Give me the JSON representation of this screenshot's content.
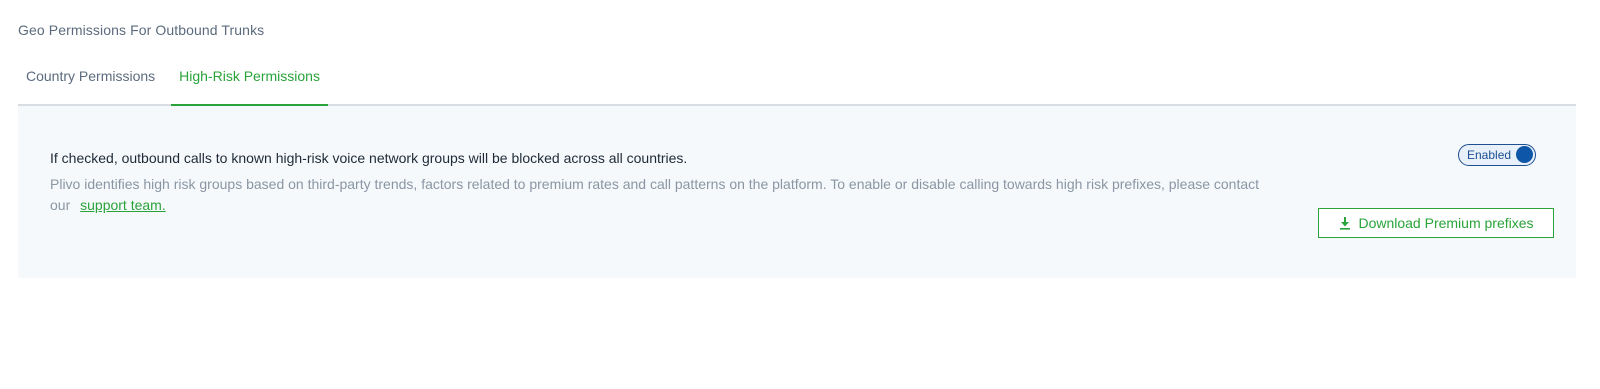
{
  "section": {
    "title": "Geo Permissions For Outbound Trunks"
  },
  "tabs": [
    {
      "label": "Country Permissions",
      "active": false
    },
    {
      "label": "High-Risk Permissions",
      "active": true
    }
  ],
  "panel": {
    "headline": "If checked, outbound calls to known high-risk voice network groups will be blocked across all countries.",
    "description": "Plivo identifies high risk groups based on third-party trends, factors related to premium rates and call patterns on the platform. To enable or disable calling towards high risk prefixes, please contact our",
    "support_link": "support team.",
    "toggle": {
      "label": "Enabled",
      "state": "on"
    },
    "download_button": {
      "label": "Download Premium prefixes",
      "icon": "download-icon"
    }
  },
  "colors": {
    "accent_green": "#2aa33a",
    "toggle_blue": "#0e56a8",
    "panel_bg": "#f6f9fc"
  }
}
